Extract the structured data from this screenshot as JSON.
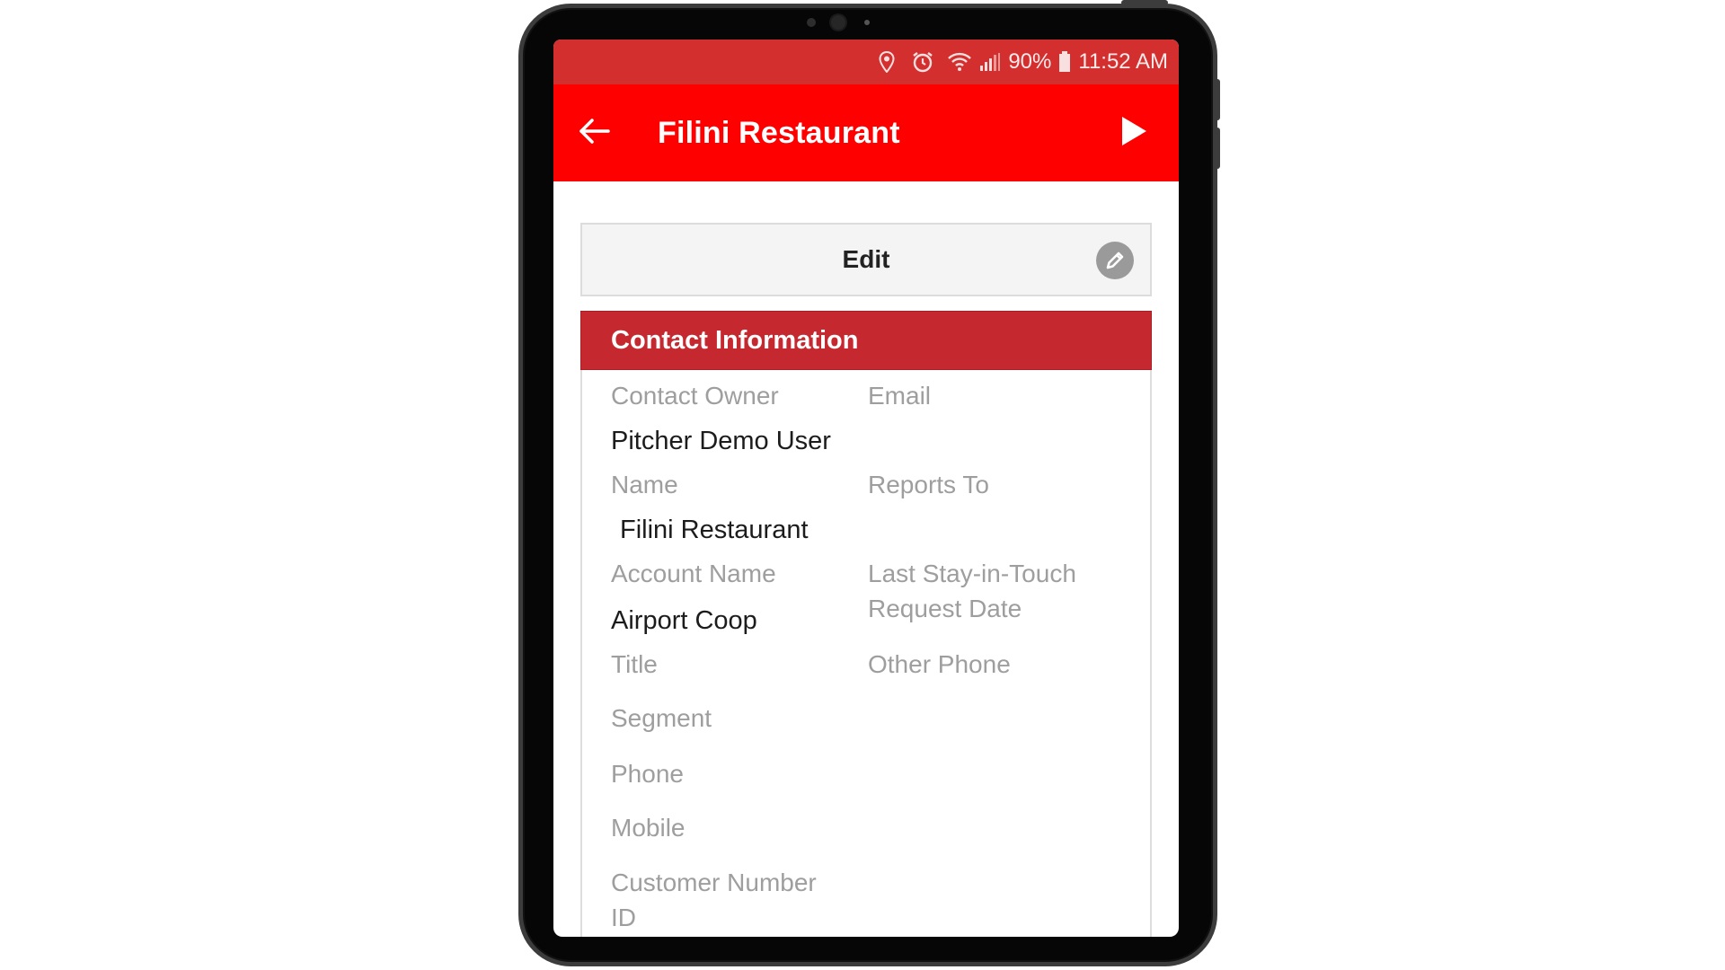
{
  "status_bar": {
    "battery": "90%",
    "time": "11:52 AM",
    "icons": [
      "location-icon",
      "alarm-icon",
      "wifi-icon",
      "signal-icon",
      "battery-icon"
    ]
  },
  "app_bar": {
    "title": "Filini Restaurant",
    "back_icon": "arrow-left-icon",
    "action_icon": "play-icon",
    "color": "#ff0000"
  },
  "edit": {
    "label": "Edit",
    "icon": "pencil-icon"
  },
  "section": {
    "title": "Contact Information",
    "color": "#c62830"
  },
  "fields": {
    "contact_owner_label": "Contact Owner",
    "contact_owner_value": "Pitcher Demo User",
    "email_label": "Email",
    "name_label": "Name",
    "name_value": "Filini Restaurant",
    "reports_to_label": "Reports To",
    "account_name_label": "Account Name",
    "account_name_value": "Airport Coop",
    "last_stay_label_1": "Last Stay-in-Touch",
    "last_stay_label_2": "Request Date",
    "title_label": "Title",
    "other_phone_label": "Other Phone",
    "segment_label": "Segment",
    "phone_label": "Phone",
    "mobile_label": "Mobile",
    "customer_number_label_1": "Customer Number",
    "customer_number_label_2": "ID"
  }
}
